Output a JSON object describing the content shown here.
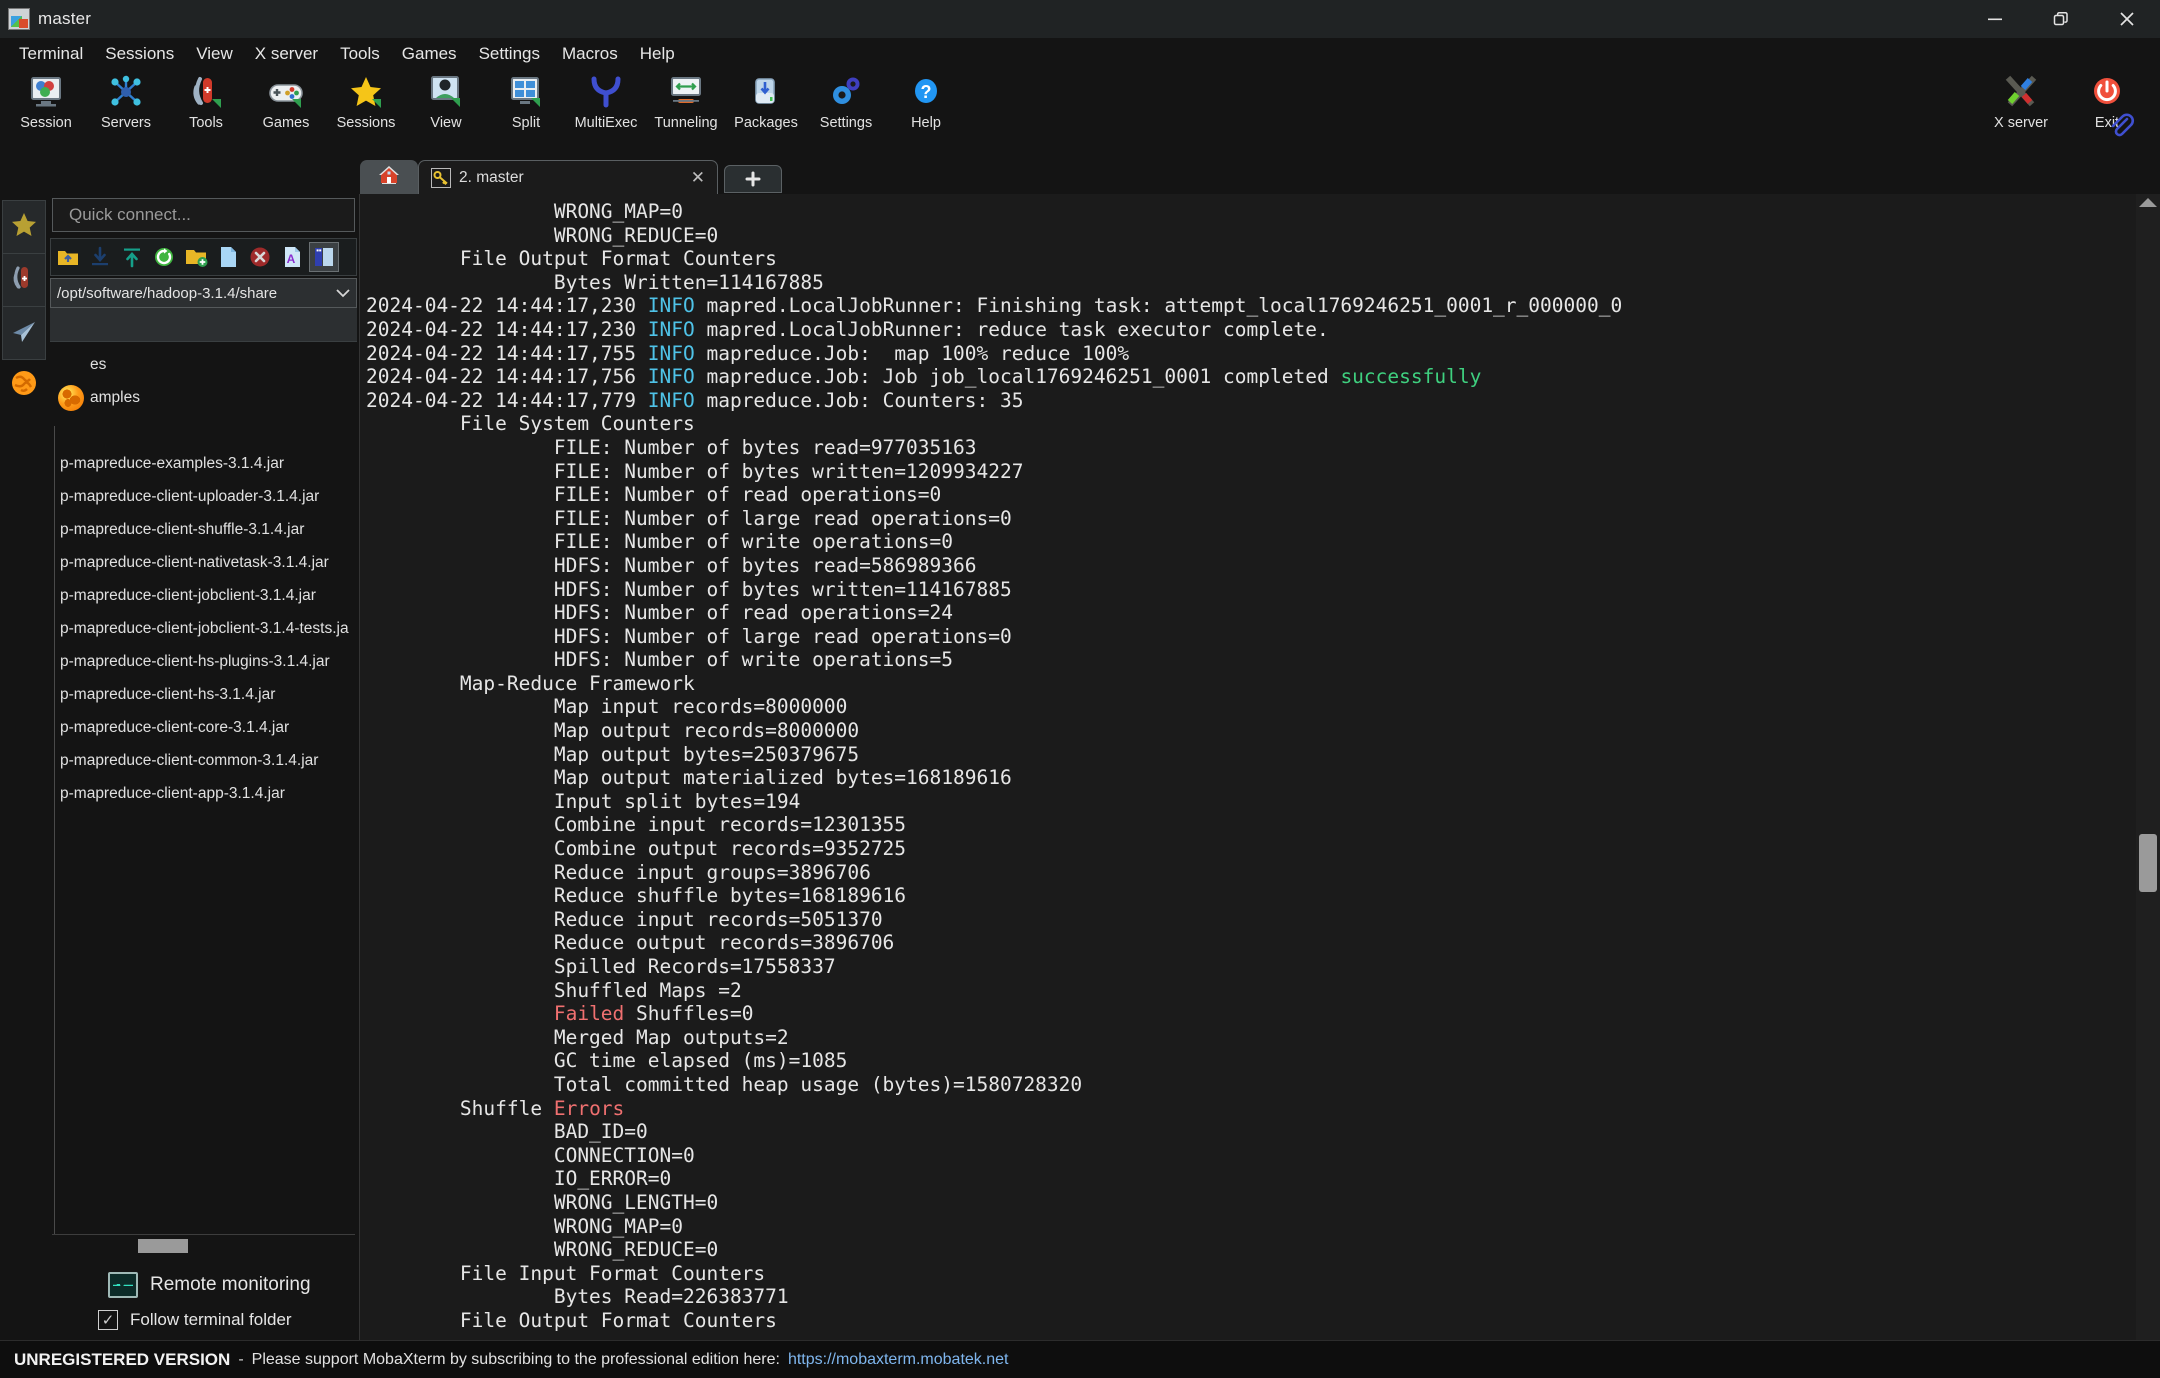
{
  "window": {
    "title": "master",
    "app_icon": "mobaxterm-icon",
    "controls": [
      {
        "name": "minimize-button",
        "glyph": "minimize-icon"
      },
      {
        "name": "restore-button",
        "glyph": "restore-icon"
      },
      {
        "name": "close-button",
        "glyph": "close-icon"
      }
    ]
  },
  "menubar": [
    {
      "label": "Terminal"
    },
    {
      "label": "Sessions"
    },
    {
      "label": "View"
    },
    {
      "label": "X server"
    },
    {
      "label": "Tools"
    },
    {
      "label": "Games"
    },
    {
      "label": "Settings"
    },
    {
      "label": "Macros"
    },
    {
      "label": "Help"
    }
  ],
  "toolbar": {
    "items": [
      {
        "label": "Session",
        "icon": "session-icon"
      },
      {
        "label": "Servers",
        "icon": "servers-icon"
      },
      {
        "label": "Tools",
        "icon": "tools-icon"
      },
      {
        "label": "Games",
        "icon": "games-icon"
      },
      {
        "label": "Sessions",
        "icon": "sessions-star-icon"
      },
      {
        "label": "View",
        "icon": "view-icon"
      },
      {
        "label": "Split",
        "icon": "split-icon"
      },
      {
        "label": "MultiExec",
        "icon": "multiexec-icon"
      },
      {
        "label": "Tunneling",
        "icon": "tunneling-icon"
      },
      {
        "label": "Packages",
        "icon": "packages-icon"
      },
      {
        "label": "Settings",
        "icon": "settings-gear-icon"
      },
      {
        "label": "Help",
        "icon": "help-question-icon"
      }
    ],
    "right_items": [
      {
        "label": "X server",
        "icon": "x-server-icon"
      },
      {
        "label": "Exit",
        "icon": "exit-power-icon"
      }
    ]
  },
  "tabs": {
    "home_tab_icon": "home-icon",
    "open": [
      {
        "label": "2. master",
        "icon": "key-icon",
        "close": "✕",
        "active": true
      }
    ],
    "add_label": "+"
  },
  "sidebar": {
    "rail": [
      {
        "name": "favorites",
        "icon": "star-icon"
      },
      {
        "name": "tools",
        "icon": "swiss-knife-icon"
      },
      {
        "name": "sftp",
        "icon": "paper-plane-icon"
      }
    ],
    "quick_connect_placeholder": "Quick connect...",
    "sftp_tools": [
      {
        "name": "parent-folder-button",
        "icon": "folder-up-icon"
      },
      {
        "name": "download-button",
        "icon": "download-icon"
      },
      {
        "name": "upload-button",
        "icon": "upload-icon"
      },
      {
        "name": "refresh-button",
        "icon": "refresh-icon"
      },
      {
        "name": "new-folder-button",
        "icon": "new-folder-icon"
      },
      {
        "name": "new-file-button",
        "icon": "new-file-icon"
      },
      {
        "name": "delete-button",
        "icon": "delete-icon"
      },
      {
        "name": "text-view-button",
        "icon": "text-file-icon"
      },
      {
        "name": "panel-layout-button",
        "icon": "panel-layout-icon",
        "selected": true
      }
    ],
    "path": "/opt/software/hadoop-3.1.4/share",
    "path_caret": "⌄",
    "partial_rows": [
      {
        "text": "es",
        "icon": null
      },
      {
        "text": "amples",
        "icon": "globe-icon"
      }
    ],
    "files": [
      {
        "name": "p-mapreduce-examples-3.1.4.jar"
      },
      {
        "name": "p-mapreduce-client-uploader-3.1.4.jar"
      },
      {
        "name": "p-mapreduce-client-shuffle-3.1.4.jar"
      },
      {
        "name": "p-mapreduce-client-nativetask-3.1.4.jar"
      },
      {
        "name": "p-mapreduce-client-jobclient-3.1.4.jar"
      },
      {
        "name": "p-mapreduce-client-jobclient-3.1.4-tests.ja"
      },
      {
        "name": "p-mapreduce-client-hs-plugins-3.1.4.jar"
      },
      {
        "name": "p-mapreduce-client-hs-3.1.4.jar"
      },
      {
        "name": "p-mapreduce-client-core-3.1.4.jar"
      },
      {
        "name": "p-mapreduce-client-common-3.1.4.jar"
      },
      {
        "name": "p-mapreduce-client-app-3.1.4.jar"
      }
    ],
    "remote_monitoring_label": "Remote monitoring",
    "follow_terminal_folder_label": "Follow terminal folder",
    "follow_terminal_folder_checked": true,
    "check_glyph": "✓"
  },
  "terminal": {
    "lines": [
      {
        "segments": [
          {
            "t": "                WRONG_MAP=0"
          }
        ]
      },
      {
        "segments": [
          {
            "t": "                WRONG_REDUCE=0"
          }
        ]
      },
      {
        "segments": [
          {
            "t": "        File Output Format Counters"
          }
        ]
      },
      {
        "segments": [
          {
            "t": "                Bytes Written=114167885"
          }
        ]
      },
      {
        "segments": [
          {
            "t": "2024-04-22 14:44:17,230 "
          },
          {
            "t": "INFO",
            "c": "c-info"
          },
          {
            "t": " mapred.LocalJobRunner: Finishing task: attempt_local1769246251_0001_r_000000_0"
          }
        ]
      },
      {
        "segments": [
          {
            "t": "2024-04-22 14:44:17,230 "
          },
          {
            "t": "INFO",
            "c": "c-info"
          },
          {
            "t": " mapred.LocalJobRunner: reduce task executor complete."
          }
        ]
      },
      {
        "segments": [
          {
            "t": "2024-04-22 14:44:17,755 "
          },
          {
            "t": "INFO",
            "c": "c-info"
          },
          {
            "t": " mapreduce.Job:  map 100% reduce 100%"
          }
        ]
      },
      {
        "segments": [
          {
            "t": "2024-04-22 14:44:17,756 "
          },
          {
            "t": "INFO",
            "c": "c-info"
          },
          {
            "t": " mapreduce.Job: Job job_local1769246251_0001 completed "
          },
          {
            "t": "successfully",
            "c": "c-ok"
          }
        ]
      },
      {
        "segments": [
          {
            "t": "2024-04-22 14:44:17,779 "
          },
          {
            "t": "INFO",
            "c": "c-info"
          },
          {
            "t": " mapreduce.Job: Counters: 35"
          }
        ]
      },
      {
        "segments": [
          {
            "t": "        File System Counters"
          }
        ]
      },
      {
        "segments": [
          {
            "t": "                FILE: Number of bytes read=977035163"
          }
        ]
      },
      {
        "segments": [
          {
            "t": "                FILE: Number of bytes written=1209934227"
          }
        ]
      },
      {
        "segments": [
          {
            "t": "                FILE: Number of read operations=0"
          }
        ]
      },
      {
        "segments": [
          {
            "t": "                FILE: Number of large read operations=0"
          }
        ]
      },
      {
        "segments": [
          {
            "t": "                FILE: Number of write operations=0"
          }
        ]
      },
      {
        "segments": [
          {
            "t": "                HDFS: Number of bytes read=586989366"
          }
        ]
      },
      {
        "segments": [
          {
            "t": "                HDFS: Number of bytes written=114167885"
          }
        ]
      },
      {
        "segments": [
          {
            "t": "                HDFS: Number of read operations=24"
          }
        ]
      },
      {
        "segments": [
          {
            "t": "                HDFS: Number of large read operations=0"
          }
        ]
      },
      {
        "segments": [
          {
            "t": "                HDFS: Number of write operations=5"
          }
        ]
      },
      {
        "segments": [
          {
            "t": "        Map-Reduce Framework"
          }
        ]
      },
      {
        "segments": [
          {
            "t": "                Map input records=8000000"
          }
        ]
      },
      {
        "segments": [
          {
            "t": "                Map output records=8000000"
          }
        ]
      },
      {
        "segments": [
          {
            "t": "                Map output bytes=250379675"
          }
        ]
      },
      {
        "segments": [
          {
            "t": "                Map output materialized bytes=168189616"
          }
        ]
      },
      {
        "segments": [
          {
            "t": "                Input split bytes=194"
          }
        ]
      },
      {
        "segments": [
          {
            "t": "                Combine input records=12301355"
          }
        ]
      },
      {
        "segments": [
          {
            "t": "                Combine output records=9352725"
          }
        ]
      },
      {
        "segments": [
          {
            "t": "                Reduce input groups=3896706"
          }
        ]
      },
      {
        "segments": [
          {
            "t": "                Reduce shuffle bytes=168189616"
          }
        ]
      },
      {
        "segments": [
          {
            "t": "                Reduce input records=5051370"
          }
        ]
      },
      {
        "segments": [
          {
            "t": "                Reduce output records=3896706"
          }
        ]
      },
      {
        "segments": [
          {
            "t": "                Spilled Records=17558337"
          }
        ]
      },
      {
        "segments": [
          {
            "t": "                Shuffled Maps =2"
          }
        ]
      },
      {
        "segments": [
          {
            "t": "                "
          },
          {
            "t": "Failed",
            "c": "c-err"
          },
          {
            "t": " Shuffles=0"
          }
        ]
      },
      {
        "segments": [
          {
            "t": "                Merged Map outputs=2"
          }
        ]
      },
      {
        "segments": [
          {
            "t": "                GC time elapsed (ms)=1085"
          }
        ]
      },
      {
        "segments": [
          {
            "t": "                Total committed heap usage (bytes)=1580728320"
          }
        ]
      },
      {
        "segments": [
          {
            "t": "        Shuffle "
          },
          {
            "t": "Errors",
            "c": "c-err"
          }
        ]
      },
      {
        "segments": [
          {
            "t": "                BAD_ID=0"
          }
        ]
      },
      {
        "segments": [
          {
            "t": "                CONNECTION=0"
          }
        ]
      },
      {
        "segments": [
          {
            "t": "                IO_ERROR=0"
          }
        ]
      },
      {
        "segments": [
          {
            "t": "                WRONG_LENGTH=0"
          }
        ]
      },
      {
        "segments": [
          {
            "t": "                WRONG_MAP=0"
          }
        ]
      },
      {
        "segments": [
          {
            "t": "                WRONG_REDUCE=0"
          }
        ]
      },
      {
        "segments": [
          {
            "t": "        File Input Format Counters"
          }
        ]
      },
      {
        "segments": [
          {
            "t": "                Bytes Read=226383771"
          }
        ]
      },
      {
        "segments": [
          {
            "t": "        File Output Format Counters"
          }
        ]
      }
    ]
  },
  "statusbar": {
    "unregistered": "UNREGISTERED VERSION",
    "dash": "-",
    "message": "Please support MobaXterm by subscribing to the professional edition here:",
    "link": "https://mobaxterm.mobatek.net"
  },
  "colors": {
    "accent_info": "#4fc3e8",
    "accent_success": "#3fd07f",
    "accent_error": "#f07070",
    "link": "#7fb6ee",
    "terminal_bg": "#1b1b1b",
    "chrome_bg": "#141414"
  }
}
